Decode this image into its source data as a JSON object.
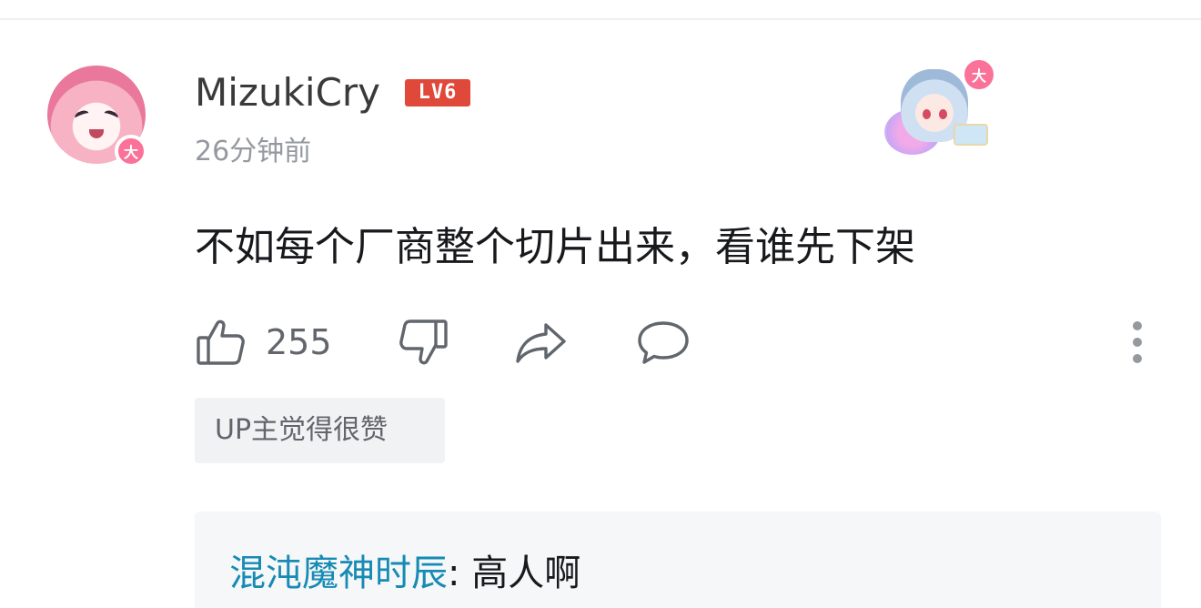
{
  "comment": {
    "username": "MizukiCry",
    "level": "LV6",
    "avatar_badge": "大",
    "time": "26分钟前",
    "decoration_badge": "大",
    "text": "不如每个厂商整个切片出来，看谁先下架",
    "likes": "255",
    "up_tag": "UP主觉得很赞"
  },
  "reply": {
    "name": "混沌魔神时辰",
    "separator": ": ",
    "text": "高人啊"
  },
  "icons": {
    "like": "thumb-up-icon",
    "dislike": "thumb-down-icon",
    "share": "share-icon",
    "comment": "comment-icon",
    "more": "more-vertical-icon"
  },
  "colors": {
    "brand_pink": "#fb7299",
    "level_red": "#e0483a",
    "reply_name": "#178bb5",
    "muted": "#9499a0"
  }
}
